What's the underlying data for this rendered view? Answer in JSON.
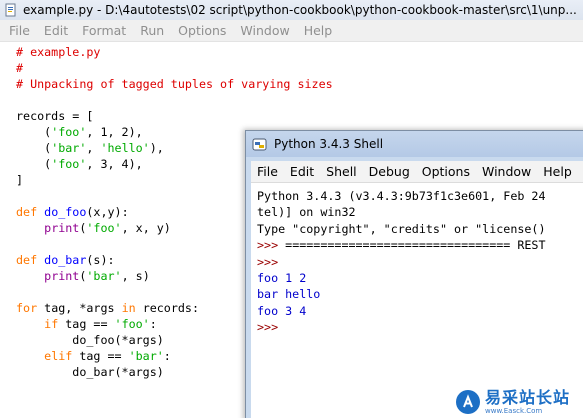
{
  "editor": {
    "title": "example.py - D:\\4autotests\\02 script\\python-cookbook\\python-cookbook-master\\src\\1\\unp...",
    "menu": [
      "File",
      "Edit",
      "Format",
      "Run",
      "Options",
      "Window",
      "Help"
    ],
    "code": [
      [
        {
          "t": "# example.py",
          "c": "com"
        }
      ],
      [
        {
          "t": "#",
          "c": "com"
        }
      ],
      [
        {
          "t": "# Unpacking of tagged tuples of varying sizes",
          "c": "com"
        }
      ],
      [],
      [
        {
          "t": "records = [",
          "c": ""
        }
      ],
      [
        {
          "t": "    (",
          "c": ""
        },
        {
          "t": "'foo'",
          "c": "str"
        },
        {
          "t": ", 1, 2),",
          "c": ""
        }
      ],
      [
        {
          "t": "    (",
          "c": ""
        },
        {
          "t": "'bar'",
          "c": "str"
        },
        {
          "t": ", ",
          "c": ""
        },
        {
          "t": "'hello'",
          "c": "str"
        },
        {
          "t": "),",
          "c": ""
        }
      ],
      [
        {
          "t": "    (",
          "c": ""
        },
        {
          "t": "'foo'",
          "c": "str"
        },
        {
          "t": ", 3, 4),",
          "c": ""
        }
      ],
      [
        {
          "t": "]",
          "c": ""
        }
      ],
      [],
      [
        {
          "t": "def ",
          "c": "kw"
        },
        {
          "t": "do_foo",
          "c": "def"
        },
        {
          "t": "(x,y):",
          "c": ""
        }
      ],
      [
        {
          "t": "    ",
          "c": ""
        },
        {
          "t": "print",
          "c": "bi"
        },
        {
          "t": "(",
          "c": ""
        },
        {
          "t": "'foo'",
          "c": "str"
        },
        {
          "t": ", x, y)",
          "c": ""
        }
      ],
      [],
      [
        {
          "t": "def ",
          "c": "kw"
        },
        {
          "t": "do_bar",
          "c": "def"
        },
        {
          "t": "(s):",
          "c": ""
        }
      ],
      [
        {
          "t": "    ",
          "c": ""
        },
        {
          "t": "print",
          "c": "bi"
        },
        {
          "t": "(",
          "c": ""
        },
        {
          "t": "'bar'",
          "c": "str"
        },
        {
          "t": ", s)",
          "c": ""
        }
      ],
      [],
      [
        {
          "t": "for",
          "c": "kw"
        },
        {
          "t": " tag, *args ",
          "c": ""
        },
        {
          "t": "in",
          "c": "kw"
        },
        {
          "t": " records:",
          "c": ""
        }
      ],
      [
        {
          "t": "    ",
          "c": ""
        },
        {
          "t": "if",
          "c": "kw"
        },
        {
          "t": " tag == ",
          "c": ""
        },
        {
          "t": "'foo'",
          "c": "str"
        },
        {
          "t": ":",
          "c": ""
        }
      ],
      [
        {
          "t": "        do_foo(*args)",
          "c": ""
        }
      ],
      [
        {
          "t": "    ",
          "c": ""
        },
        {
          "t": "elif",
          "c": "kw"
        },
        {
          "t": " tag == ",
          "c": ""
        },
        {
          "t": "'bar'",
          "c": "str"
        },
        {
          "t": ":",
          "c": ""
        }
      ],
      [
        {
          "t": "        do_bar(*args)",
          "c": ""
        }
      ]
    ]
  },
  "shell": {
    "title": "Python 3.4.3 Shell",
    "menu": [
      "File",
      "Edit",
      "Shell",
      "Debug",
      "Options",
      "Window",
      "Help"
    ],
    "lines": [
      [
        {
          "t": "Python 3.4.3 (v3.4.3:9b73f1c3e601, Feb 24",
          "c": ""
        }
      ],
      [
        {
          "t": "tel)] on win32",
          "c": ""
        }
      ],
      [
        {
          "t": "Type \"copyright\", \"credits\" or \"license()",
          "c": ""
        }
      ],
      [
        {
          "t": ">>> ",
          "c": "prompt"
        },
        {
          "t": "================================ REST",
          "c": ""
        }
      ],
      [
        {
          "t": ">>>",
          "c": "prompt"
        }
      ],
      [
        {
          "t": "foo 1 2",
          "c": "out"
        }
      ],
      [
        {
          "t": "bar hello",
          "c": "out"
        }
      ],
      [
        {
          "t": "foo 3 4",
          "c": "out"
        }
      ],
      [
        {
          "t": ">>>",
          "c": "prompt"
        }
      ]
    ]
  },
  "watermark": {
    "name": "易采站长站",
    "url": "www.Easck.Com"
  },
  "colors": {
    "comment": "#dd0000",
    "keyword": "#ff7700",
    "string": "#00aa00",
    "definition": "#0000ff",
    "builtin": "#900090",
    "prompt": "#990000",
    "output": "#0000cc"
  }
}
